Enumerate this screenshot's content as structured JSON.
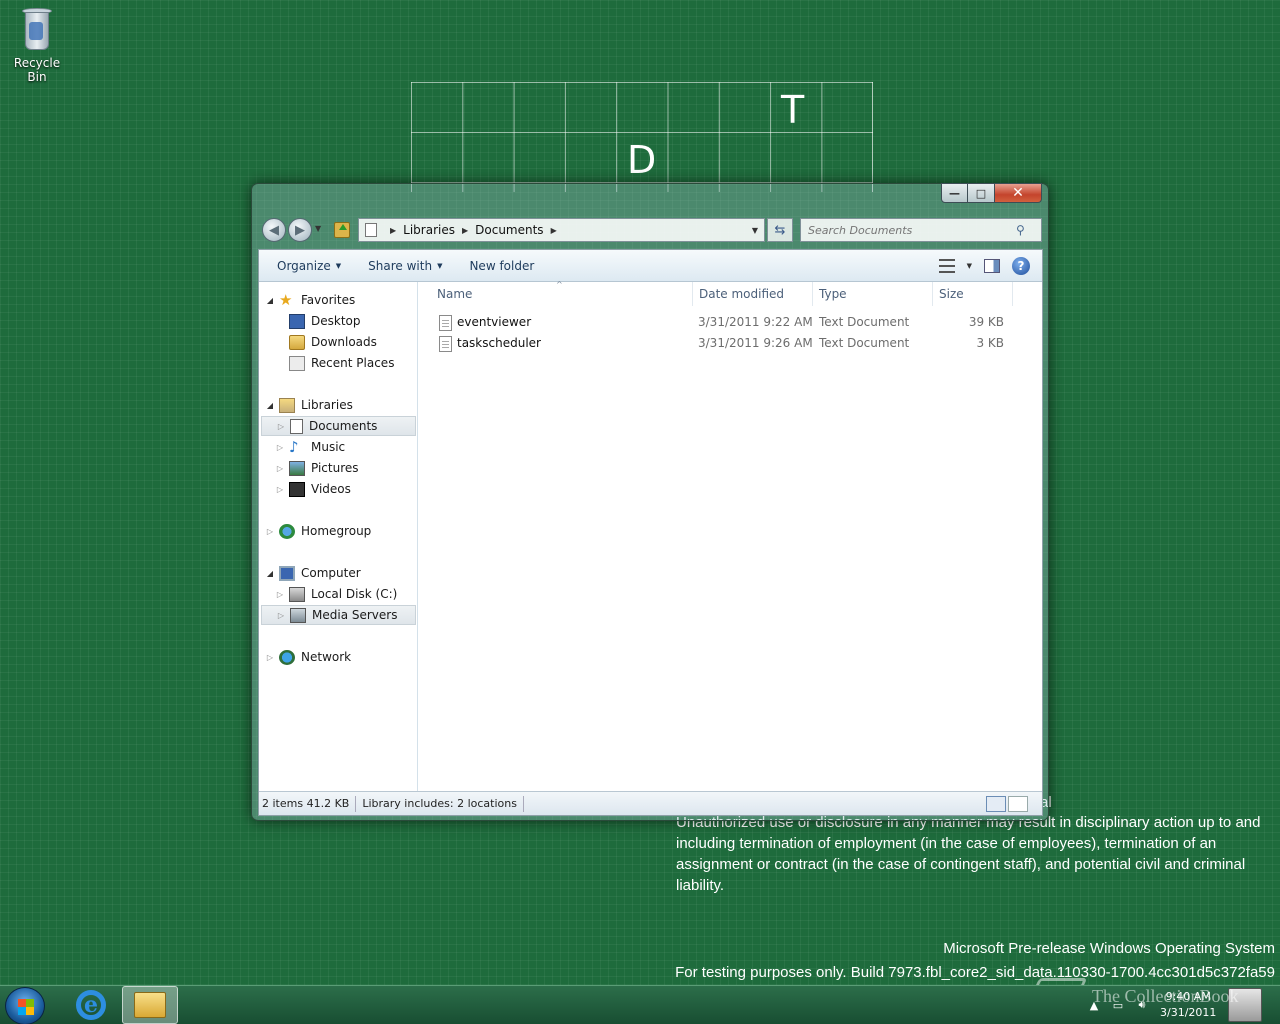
{
  "desktop": {
    "recycle_bin_label": "Recycle Bin",
    "tiles": [
      "T",
      "D"
    ],
    "legal_heading": "al",
    "legal_text": "Unauthorized use or disclosure in any manner may result in disciplinary action up to and including termination of employment (in the case of employees), termination of an assignment or contract (in the case of contingent staff), and potential civil and criminal liability.",
    "os_line": "Microsoft Pre-release Windows Operating System",
    "build_line": "For testing purposes only. Build 7973.fbl_core2_sid_data.110330-1700.4cc301d5c372fa59",
    "watermark": "The CollectionBook"
  },
  "window": {
    "caption": {
      "minimize": "—",
      "maximize": "□",
      "close": "✕"
    },
    "address": {
      "crumbs": [
        "Libraries",
        "Documents"
      ]
    },
    "search": {
      "placeholder": "Search Documents"
    },
    "toolbar": {
      "organize": "Organize",
      "share_with": "Share with",
      "new_folder": "New folder"
    },
    "nav": {
      "favorites": "Favorites",
      "desktop": "Desktop",
      "downloads": "Downloads",
      "recent_places": "Recent Places",
      "libraries": "Libraries",
      "documents": "Documents",
      "music": "Music",
      "pictures": "Pictures",
      "videos": "Videos",
      "homegroup": "Homegroup",
      "computer": "Computer",
      "local_disk": "Local Disk (C:)",
      "media_servers": "Media Servers",
      "network": "Network"
    },
    "columns": {
      "name": "Name",
      "date": "Date modified",
      "type": "Type",
      "size": "Size"
    },
    "files": [
      {
        "name": "eventviewer",
        "date": "3/31/2011 9:22 AM",
        "type": "Text Document",
        "size": "39 KB"
      },
      {
        "name": "taskscheduler",
        "date": "3/31/2011 9:26 AM",
        "type": "Text Document",
        "size": "3 KB"
      }
    ],
    "status": {
      "items": "2 items  41.2 KB",
      "library": "Library includes:  2 locations"
    }
  },
  "taskbar": {
    "time": "9:40 AM",
    "date": "3/31/2011"
  }
}
